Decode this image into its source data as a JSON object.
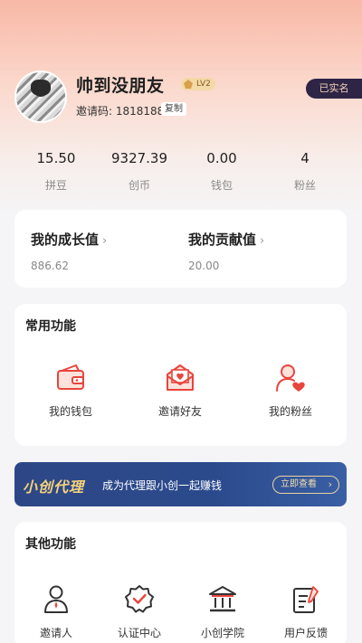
{
  "profile": {
    "username": "帅到没朋友",
    "level": "LV2",
    "invite_label": "邀请码: 1818188",
    "copy_label": "复制",
    "verified_badge": "已实名"
  },
  "stats": [
    {
      "value": "15.50",
      "label": "拼豆"
    },
    {
      "value": "9327.39",
      "label": "创币"
    },
    {
      "value": "0.00",
      "label": "钱包"
    },
    {
      "value": "4",
      "label": "粉丝"
    }
  ],
  "growth": {
    "growth_title": "我的成长值",
    "growth_value": "886.62",
    "contribution_title": "我的贡献值",
    "contribution_value": "20.00",
    "chevron": "›"
  },
  "common_functions": {
    "title": "常用功能",
    "items": [
      {
        "label": "我的钱包",
        "icon": "wallet-icon"
      },
      {
        "label": "邀请好友",
        "icon": "invite-envelope-icon"
      },
      {
        "label": "我的粉丝",
        "icon": "fans-icon"
      }
    ]
  },
  "banner": {
    "brand": "小创代理",
    "text": "成为代理跟小创一起赚钱",
    "button": "立即查看",
    "arrow": "›"
  },
  "other_functions": {
    "title": "其他功能",
    "items": [
      {
        "label": "邀请人",
        "icon": "inviter-icon"
      },
      {
        "label": "认证中心",
        "icon": "certification-icon"
      },
      {
        "label": "小创学院",
        "icon": "academy-icon"
      },
      {
        "label": "用户反馈",
        "icon": "feedback-icon"
      }
    ]
  },
  "colors": {
    "accent_red": "#e8453c",
    "badge_dark": "#2e2446",
    "banner_blue": "#2d4786",
    "gold": "#f5d27a"
  }
}
